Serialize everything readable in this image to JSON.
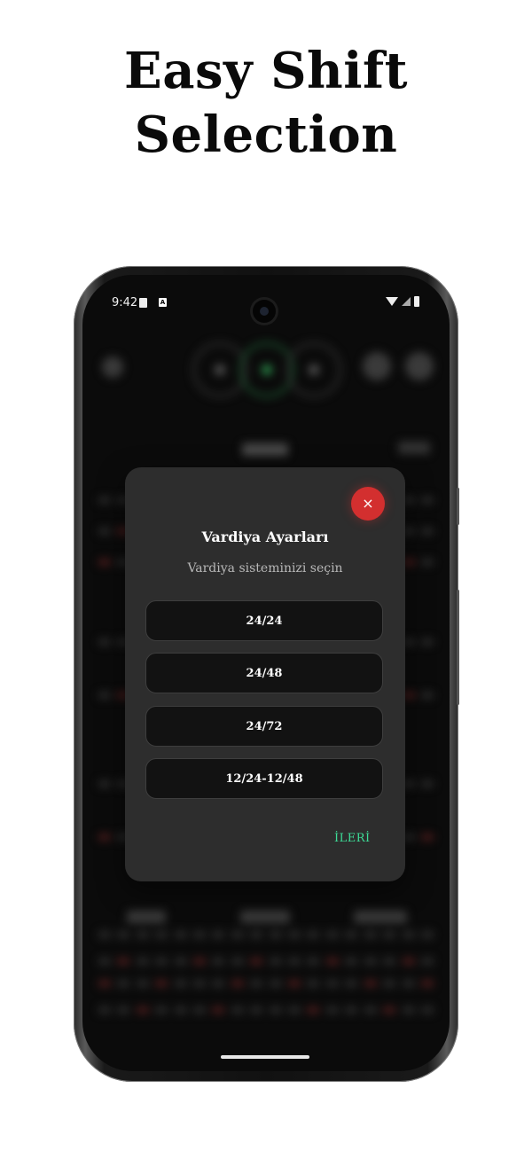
{
  "headline": {
    "line1": "Easy Shift",
    "line2": "Selection"
  },
  "status_bar": {
    "time": "9:42",
    "notification_badge": "A"
  },
  "dialog": {
    "title": "Vardiya Ayarları",
    "subtitle": "Vardiya sisteminizi seçin",
    "close_icon": "×",
    "options": [
      "24/24",
      "24/48",
      "24/72",
      "12/24-12/48"
    ],
    "next_label": "İLERİ"
  },
  "colors": {
    "accent_green": "#3ddc97",
    "close_red": "#d32f2f",
    "dialog_bg": "#2d2d2d",
    "option_bg": "#121212"
  }
}
